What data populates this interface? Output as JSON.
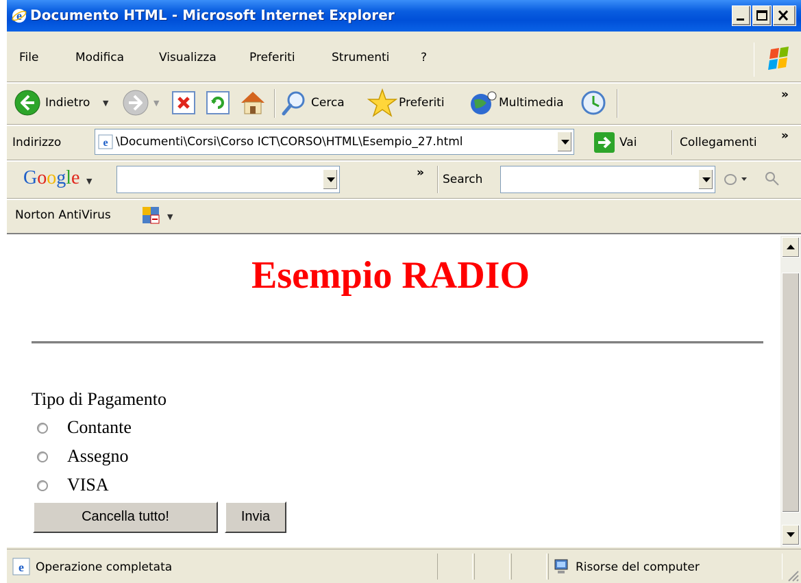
{
  "window": {
    "title": "Documento HTML - Microsoft Internet Explorer",
    "title_color": "#0050D8"
  },
  "menu": {
    "items": [
      "File",
      "Modifica",
      "Visualizza",
      "Preferiti",
      "Strumenti",
      "?"
    ]
  },
  "toolbar": {
    "back_label": "Indietro",
    "search_label": "Cerca",
    "favorites_label": "Preferiti",
    "media_label": "Multimedia",
    "more_glyph": "»"
  },
  "address": {
    "label": "Indirizzo",
    "url": "\\Documenti\\Corsi\\Corso ICT\\CORSO\\HTML\\Esempio_27.html",
    "go_label": "Vai",
    "links_label": "Collegamenti",
    "more_glyph": "»"
  },
  "google": {
    "logo": "Google",
    "search_label": "Search",
    "more_glyph": "»",
    "value": "",
    "search_value": ""
  },
  "norton": {
    "label": "Norton AntiVirus"
  },
  "page": {
    "heading": "Esempio RADIO",
    "heading_color": "#FF0000",
    "form_label": "Tipo di Pagamento",
    "options": [
      "Contante",
      "Assegno",
      "VISA"
    ],
    "selected": null,
    "reset_label": "Cancella tutto!",
    "submit_label": "Invia"
  },
  "status": {
    "text": "Operazione completata",
    "zone": "Risorse del computer"
  }
}
